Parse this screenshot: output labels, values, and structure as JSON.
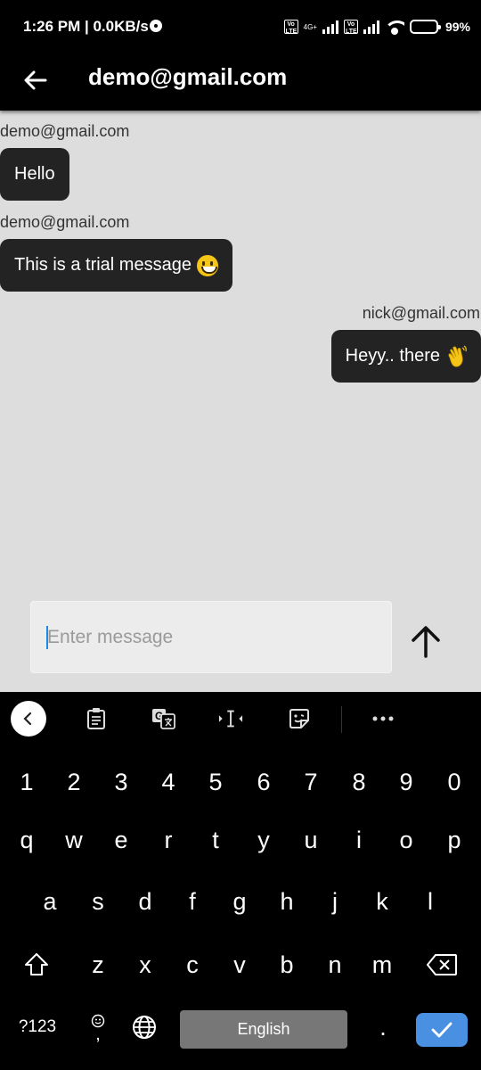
{
  "status_bar": {
    "time": "1:26 PM | 0.0KB/s",
    "volte_label": "Vo LTE",
    "network_label": "4G+",
    "battery_percent": "99%"
  },
  "app_bar": {
    "title": "demo@gmail.com"
  },
  "messages": [
    {
      "sender": "demo@gmail.com",
      "text": "Hello",
      "emoji": "",
      "side": "left"
    },
    {
      "sender": "demo@gmail.com",
      "text": "This is a trial message",
      "emoji": "grinning-face",
      "side": "left"
    },
    {
      "sender": "nick@gmail.com",
      "text": "Heyy.. there",
      "emoji": "waving-hand",
      "side": "right"
    }
  ],
  "composer": {
    "placeholder": "Enter message"
  },
  "keyboard": {
    "number_row": [
      "1",
      "2",
      "3",
      "4",
      "5",
      "6",
      "7",
      "8",
      "9",
      "0"
    ],
    "row1": [
      "q",
      "w",
      "e",
      "r",
      "t",
      "y",
      "u",
      "i",
      "o",
      "p"
    ],
    "row2": [
      "a",
      "s",
      "d",
      "f",
      "g",
      "h",
      "j",
      "k",
      "l"
    ],
    "row3": [
      "z",
      "x",
      "c",
      "v",
      "b",
      "n",
      "m"
    ],
    "symbols_label": "?123",
    "comma_label": ",",
    "space_label": "English",
    "period_label": ".",
    "toolbar_icons": [
      "collapse-icon",
      "clipboard-icon",
      "translate-icon",
      "cursor-icon",
      "sticker-icon",
      "more-icon"
    ]
  },
  "colors": {
    "chat_background": "#dddddd",
    "bubble": "#232323",
    "accent": "#4a90e2"
  }
}
